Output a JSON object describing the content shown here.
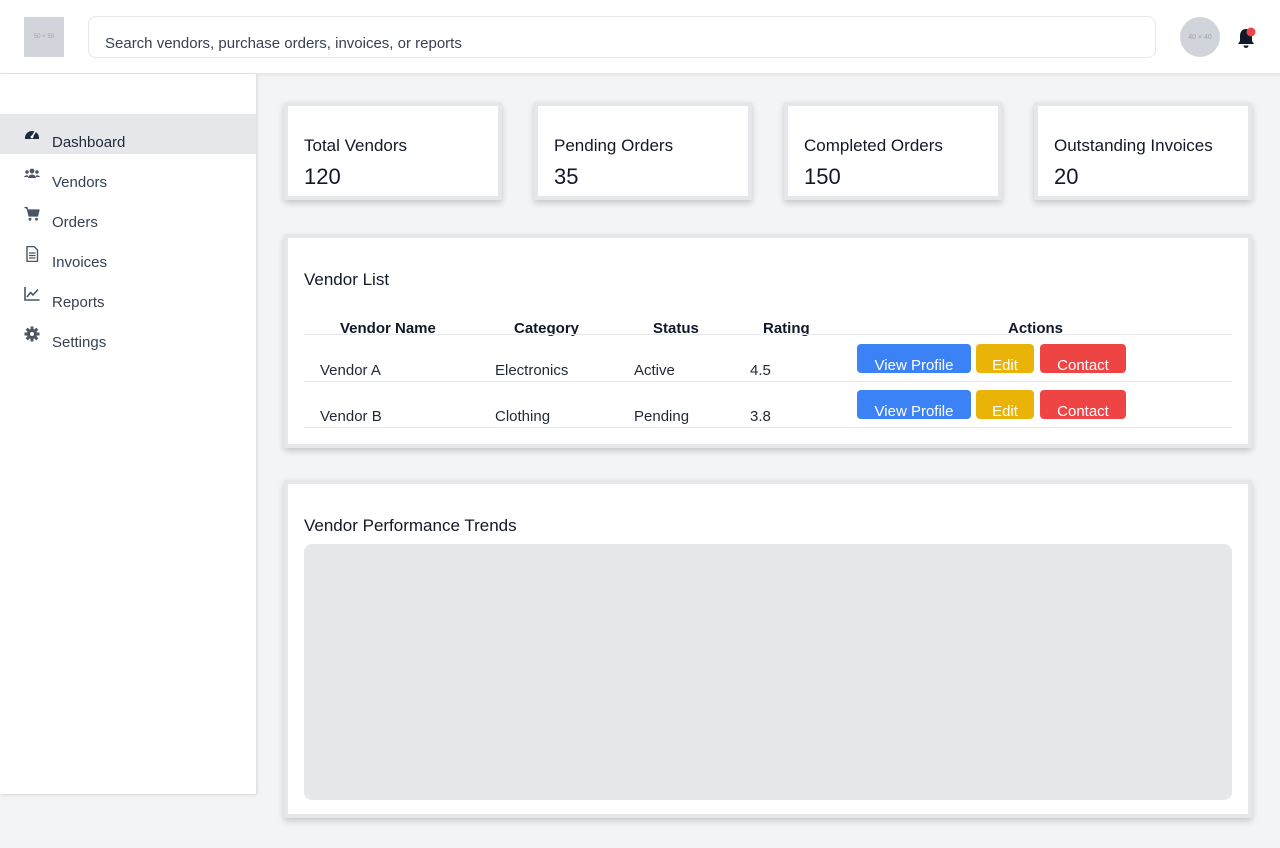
{
  "header": {
    "logo_text": "50 × 50",
    "search_placeholder": "Search vendors, purchase orders, invoices, or reports",
    "avatar_text": "40 × 40"
  },
  "sidebar": {
    "items": [
      {
        "label": "Dashboard",
        "icon": "dashboard-icon",
        "active": true
      },
      {
        "label": "Vendors",
        "icon": "users-icon",
        "active": false
      },
      {
        "label": "Orders",
        "icon": "cart-icon",
        "active": false
      },
      {
        "label": "Invoices",
        "icon": "invoice-icon",
        "active": false
      },
      {
        "label": "Reports",
        "icon": "chart-line-icon",
        "active": false
      },
      {
        "label": "Settings",
        "icon": "gear-icon",
        "active": false
      }
    ]
  },
  "stats": [
    {
      "label": "Total Vendors",
      "value": "120"
    },
    {
      "label": "Pending Orders",
      "value": "35"
    },
    {
      "label": "Completed Orders",
      "value": "150"
    },
    {
      "label": "Outstanding Invoices",
      "value": "20"
    }
  ],
  "vendor_list": {
    "title": "Vendor List",
    "columns": [
      "Vendor Name",
      "Category",
      "Status",
      "Rating",
      "Actions"
    ],
    "rows": [
      {
        "name": "Vendor A",
        "category": "Electronics",
        "status": "Active",
        "rating": "4.5"
      },
      {
        "name": "Vendor B",
        "category": "Clothing",
        "status": "Pending",
        "rating": "3.8"
      }
    ],
    "actions": {
      "view": "View Profile",
      "edit": "Edit",
      "contact": "Contact"
    }
  },
  "trends": {
    "title": "Vendor Performance Trends"
  },
  "colors": {
    "primary": "#3b82f6",
    "warning": "#eab308",
    "danger": "#ef4444",
    "notification_dot": "#ef4444"
  }
}
